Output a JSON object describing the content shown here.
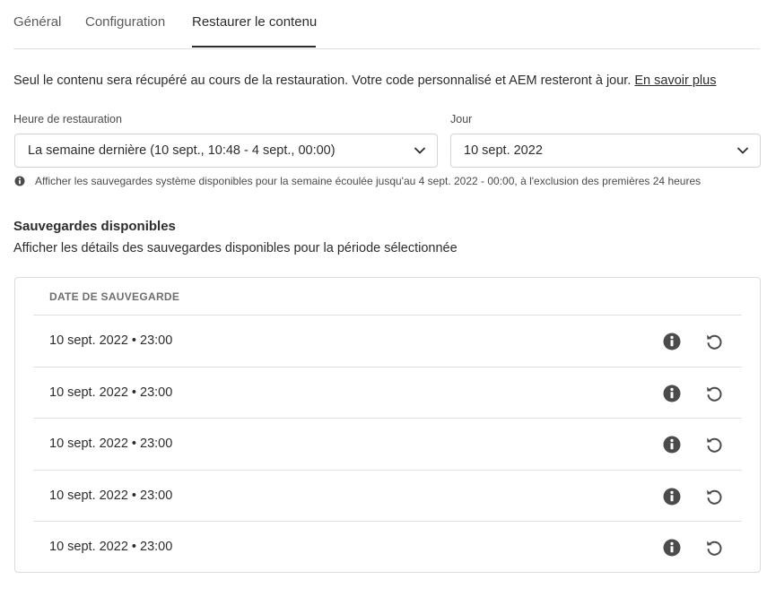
{
  "tabs": [
    {
      "label": "Général",
      "active": false
    },
    {
      "label": "Configuration",
      "active": false
    },
    {
      "label": "Restaurer le contenu",
      "active": true
    }
  ],
  "intro": {
    "text": "Seul le contenu sera récupéré au cours de la restauration. Votre code personnalisé et AEM resteront à jour. ",
    "link": "En savoir plus"
  },
  "fields": {
    "restore_time": {
      "label": "Heure de restauration",
      "value": "La semaine dernière (10 sept., 10:48 - 4 sept., 00:00)"
    },
    "day": {
      "label": "Jour",
      "value": "10 sept. 2022"
    }
  },
  "help_text": "Afficher les sauvegardes système disponibles pour la semaine écoulée jusqu'au 4 sept. 2022 - 00:00, à l'exclusion des premières 24 heures",
  "backups": {
    "title": "Sauvegardes disponibles",
    "subtitle": "Afficher les détails des sauvegardes disponibles pour la période sélectionnée",
    "column_header": "DATE DE SAUVEGARDE",
    "rows": [
      {
        "date": "10 sept. 2022 • 23:00"
      },
      {
        "date": "10 sept. 2022 • 23:00"
      },
      {
        "date": "10 sept. 2022 • 23:00"
      },
      {
        "date": "10 sept. 2022 • 23:00"
      },
      {
        "date": "10 sept. 2022 • 23:00"
      }
    ]
  },
  "icons": {
    "info": "info-icon",
    "restore": "restore-icon",
    "dropdown": "chevron-down-icon"
  },
  "colors": {
    "text": "#2c2c2c",
    "muted": "#6e6e6e",
    "icon": "#4b4b4b",
    "border": "#e1e1e1"
  }
}
